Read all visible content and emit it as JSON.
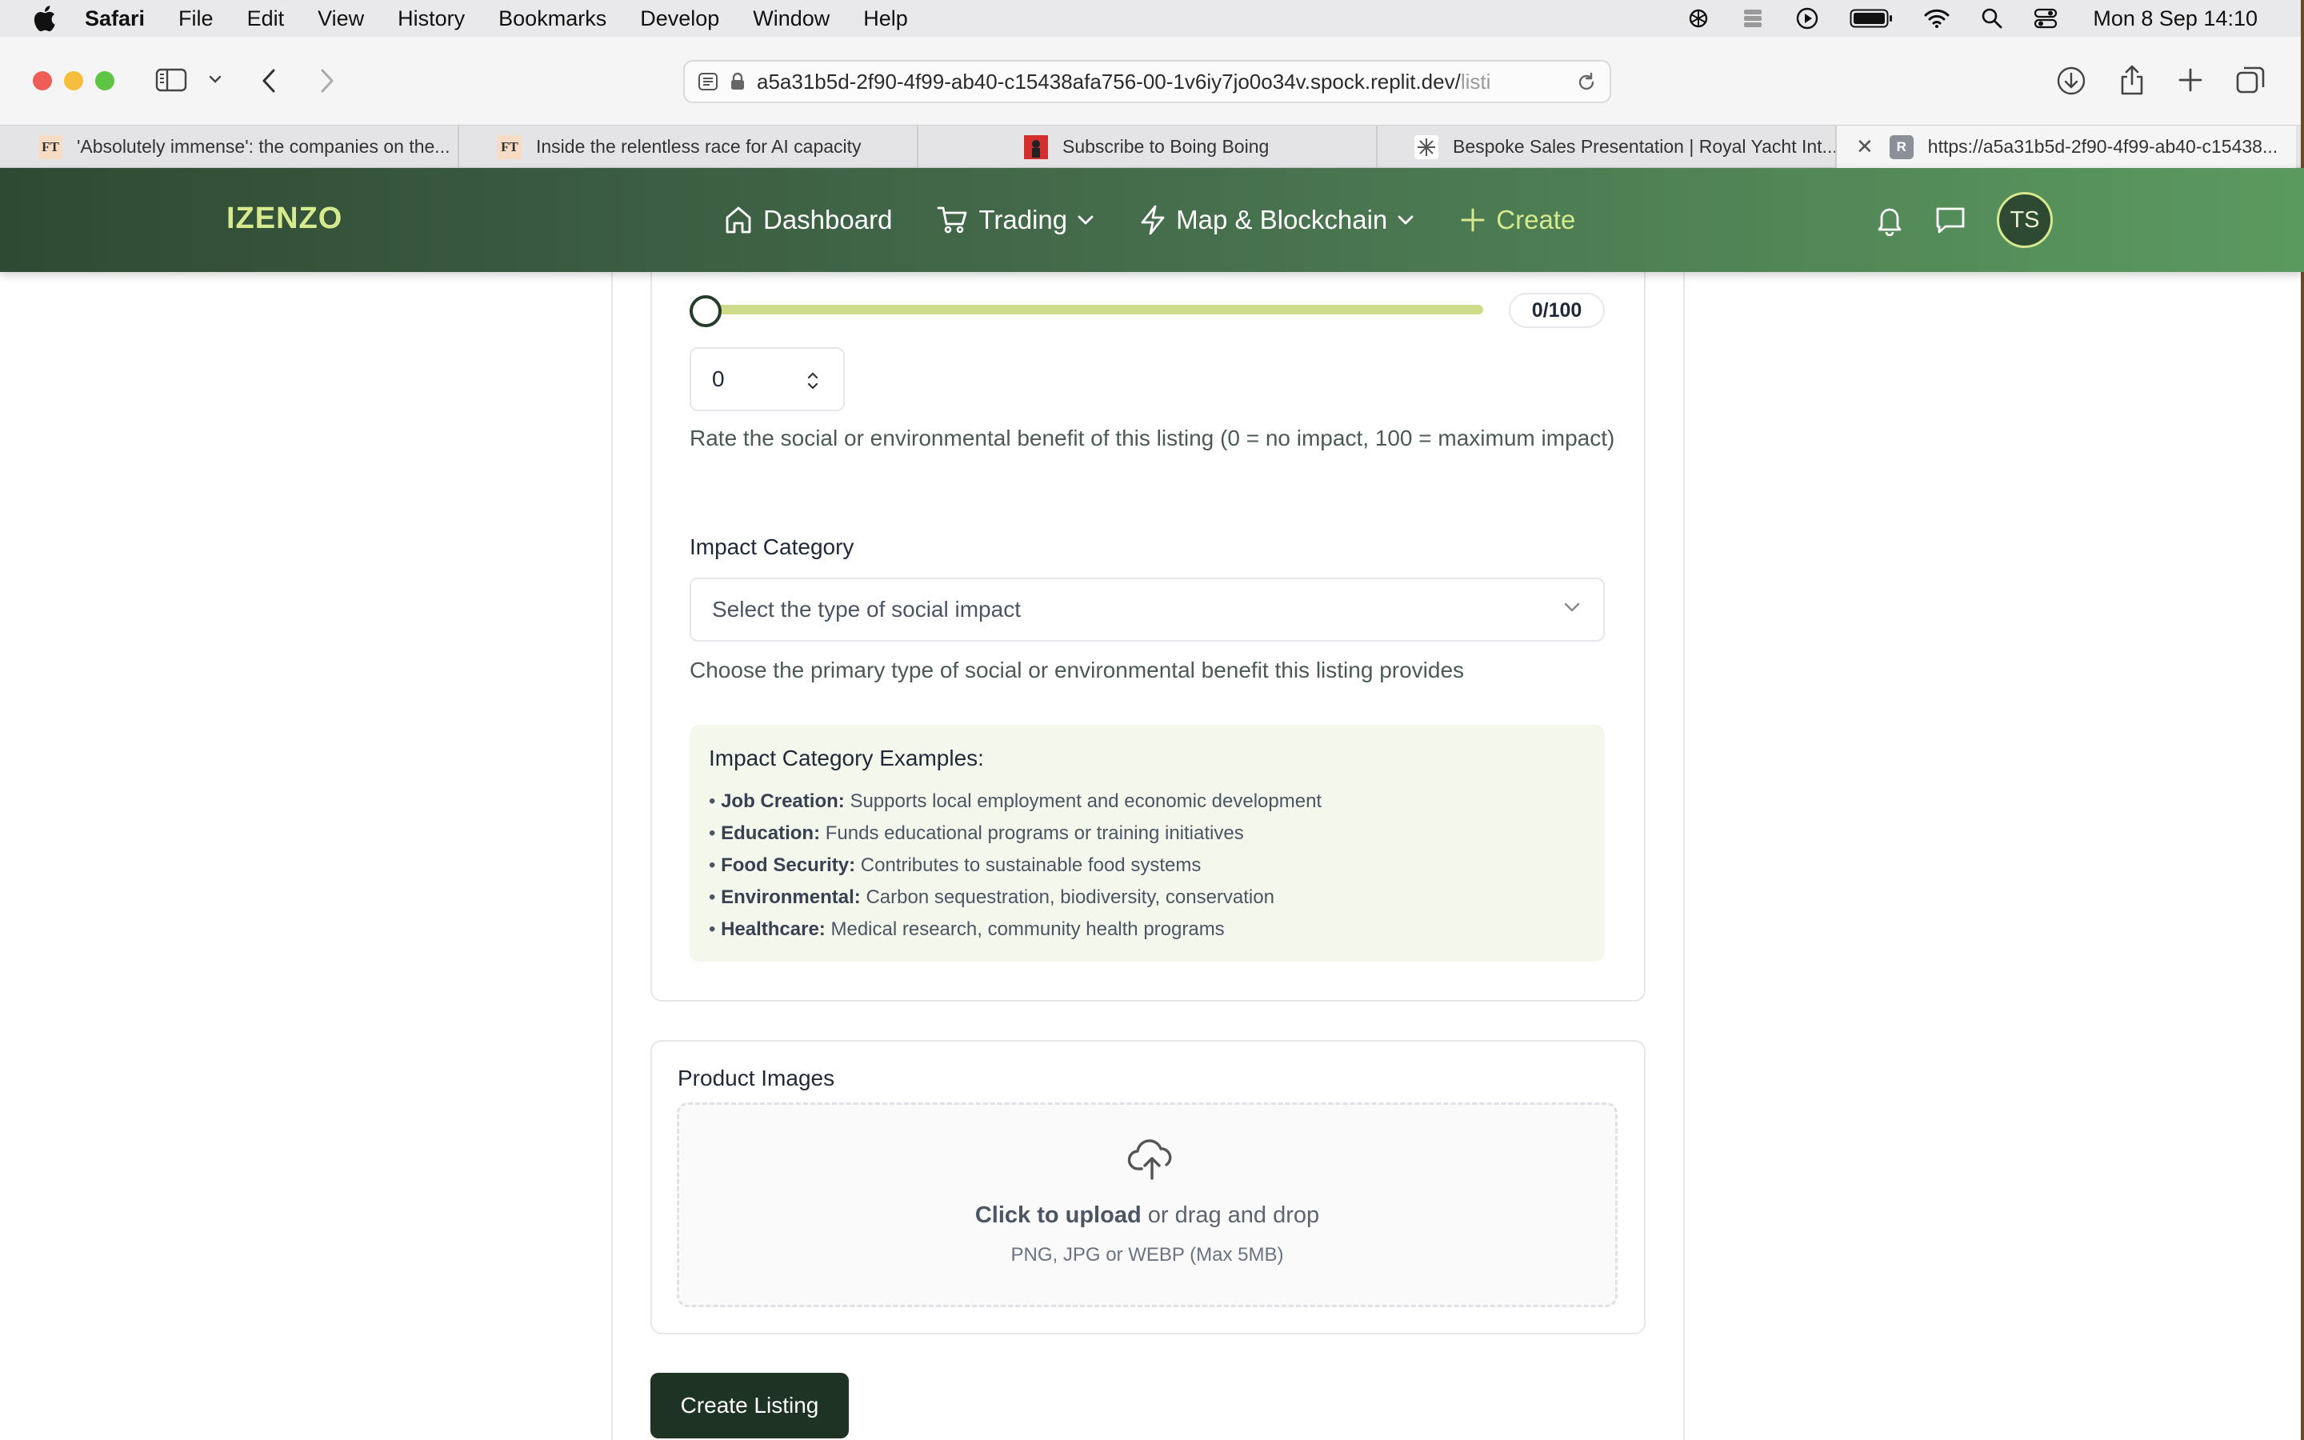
{
  "menubar": {
    "app": "Safari",
    "items": [
      "File",
      "Edit",
      "View",
      "History",
      "Bookmarks",
      "Develop",
      "Window",
      "Help"
    ],
    "clock": "Mon 8 Sep  14:10",
    "status_icons": [
      "chatgpt-icon",
      "stack-icon",
      "play-icon",
      "battery-icon",
      "wifi-icon",
      "spotlight-icon",
      "control-center-icon"
    ]
  },
  "browser": {
    "url_main": "a5a31b5d-2f90-4f99-ab40-c15438afa756-00-1v6iy7jo0o34v.spock.replit.dev/",
    "url_fade": "listi",
    "tabs": [
      {
        "fav": "FT",
        "title": "'Absolutely immense': the companies on the..."
      },
      {
        "fav": "FT",
        "title": "Inside the relentless race for AI capacity"
      },
      {
        "fav": "",
        "title": "Subscribe to Boing Boing"
      },
      {
        "fav": "",
        "title": "Bespoke Sales Presentation | Royal Yacht Int..."
      },
      {
        "fav": "R",
        "title": "https://a5a31b5d-2f90-4f99-ab40-c15438..."
      }
    ]
  },
  "nav": {
    "logo": "IZENZO",
    "dashboard": "Dashboard",
    "trading": "Trading",
    "map": "Map & Blockchain",
    "create": "Create",
    "avatar": "TS"
  },
  "form": {
    "slider_value": 0,
    "slider_display": "0/100",
    "number_value": "0",
    "score_help": "Rate the social or environmental benefit of this listing (0 = no impact, 100 = maximum impact)",
    "category_label": "Impact Category",
    "category_placeholder": "Select the type of social impact",
    "category_help": "Choose the primary type of social or environmental benefit this listing provides",
    "examples_title": "Impact Category Examples:",
    "examples": [
      {
        "name": "Job Creation:",
        "desc": "Supports local employment and economic development"
      },
      {
        "name": "Education:",
        "desc": "Funds educational programs or training initiatives"
      },
      {
        "name": "Food Security:",
        "desc": "Contributes to sustainable food systems"
      },
      {
        "name": "Environmental:",
        "desc": "Carbon sequestration, biodiversity, conservation"
      },
      {
        "name": "Healthcare:",
        "desc": "Medical research, community health programs"
      }
    ],
    "images_label": "Product Images",
    "upload_bold": "Click to upload",
    "upload_rest": "or drag and drop",
    "upload_sub": "PNG, JPG or WEBP (Max 5MB)",
    "submit": "Create Listing"
  },
  "colors": {
    "nav_dark": "#2f4a33",
    "nav_light": "#5b9a5f",
    "accent_lime": "#d6e98e",
    "slider_track": "#cddc8a",
    "examples_bg": "#f3f7ec",
    "button_dark": "#1f3325"
  }
}
